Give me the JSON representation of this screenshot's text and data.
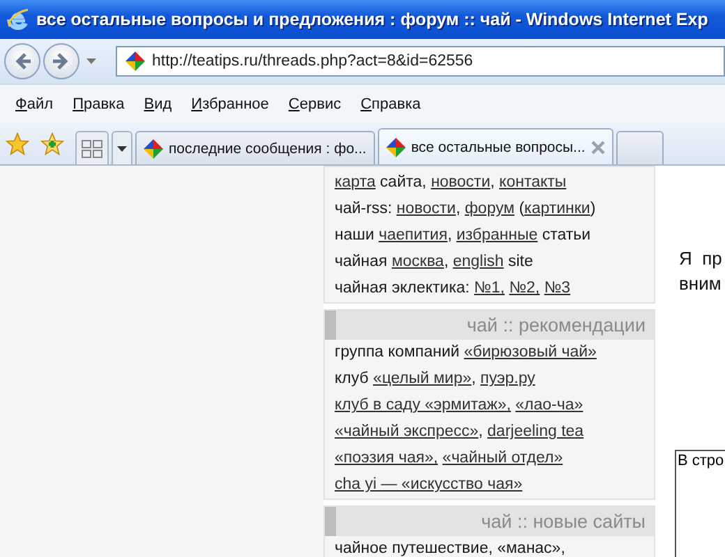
{
  "window": {
    "title": "все остальные вопросы и предложения : форум :: чай - Windows Internet Exp"
  },
  "address_bar": {
    "url": "http://teatips.ru/threads.php?act=8&id=62556"
  },
  "menu": [
    "Файл",
    "Правка",
    "Вид",
    "Избранное",
    "Сервис",
    "Справка"
  ],
  "tabs": [
    {
      "label": "последние сообщения : фо...",
      "selected": false
    },
    {
      "label": "все остальные вопросы...",
      "selected": true
    }
  ],
  "sidebar": [
    {
      "lines": [
        [
          {
            "text": "карта",
            "link": true
          },
          {
            "text": " сайта, ",
            "link": false
          },
          {
            "text": "новости",
            "link": true
          },
          {
            "text": ", ",
            "link": false
          },
          {
            "text": "контакты",
            "link": true
          }
        ],
        [
          {
            "text": "чай-rss: ",
            "link": false
          },
          {
            "text": "новости",
            "link": true
          },
          {
            "text": ", ",
            "link": false
          },
          {
            "text": "форум",
            "link": true
          },
          {
            "text": " (",
            "link": false
          },
          {
            "text": "картинки",
            "link": true
          },
          {
            "text": ")",
            "link": false
          }
        ],
        [
          {
            "text": "наши ",
            "link": false
          },
          {
            "text": "чаепития",
            "link": true
          },
          {
            "text": ", ",
            "link": false
          },
          {
            "text": "избранные",
            "link": true
          },
          {
            "text": " статьи",
            "link": false
          }
        ],
        [
          {
            "text": "чайная ",
            "link": false
          },
          {
            "text": "москва",
            "link": true
          },
          {
            "text": ", ",
            "link": false
          },
          {
            "text": "english",
            "link": true
          },
          {
            "text": " site",
            "link": false
          }
        ],
        [
          {
            "text": "чайная эклектика: ",
            "link": false
          },
          {
            "text": "№1,",
            "link": true
          },
          {
            "text": "№2,",
            "link": true
          },
          {
            "text": "№3",
            "link": true
          }
        ]
      ]
    },
    {
      "title": "чай :: рекомендации",
      "lines": [
        [
          {
            "text": "группа компаний ",
            "link": false
          },
          {
            "text": "«бирюзовый чай»",
            "link": true
          }
        ],
        [
          {
            "text": "клуб ",
            "link": false
          },
          {
            "text": "«целый мир»",
            "link": true
          },
          {
            "text": ", ",
            "link": false
          },
          {
            "text": "пуэр.ру",
            "link": true
          }
        ],
        [
          {
            "text": "клуб в саду «эрмитаж»,",
            "link": true
          },
          {
            "text": "«лао-ча»",
            "link": true
          }
        ],
        [
          {
            "text": "«чайный экспресс»",
            "link": true
          },
          {
            "text": ", ",
            "link": false
          },
          {
            "text": "darjeeling tea",
            "link": true
          }
        ],
        [
          {
            "text": "«поэзия чая»,",
            "link": true
          },
          {
            "text": "«чайный отдел»",
            "link": true
          }
        ],
        [
          {
            "text": "cha yi — «искусство чая»",
            "link": true
          }
        ]
      ]
    },
    {
      "title": "чай :: новые сайты",
      "lines": [
        [
          {
            "text": "чайное путешествие, «манас»,",
            "link": false
          }
        ]
      ]
    }
  ],
  "content": {
    "paragraph_lines": [
      "Я  пр",
      "вним"
    ],
    "textarea": {
      "value": "В стро"
    }
  }
}
